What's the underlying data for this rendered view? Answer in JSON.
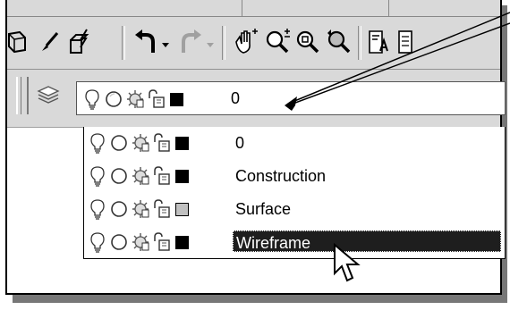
{
  "layer_toolbar": {
    "current_layer": {
      "name": "0",
      "color": "#000000"
    }
  },
  "layer_dropdown": {
    "items": [
      {
        "name": "0",
        "color": "#000000",
        "selected": false
      },
      {
        "name": "Construction",
        "color": "#000000",
        "selected": false
      },
      {
        "name": "Surface",
        "color": "#c0c0c0",
        "selected": false
      },
      {
        "name": "Wireframe",
        "color": "#000000",
        "selected": true
      }
    ]
  },
  "icons": {
    "toolbar": [
      "new-3d-icon",
      "match-properties-brush-icon",
      "paint-lightning-icon",
      "undo-icon",
      "redo-icon",
      "pan-hand-icon",
      "zoom-realtime-icon",
      "zoom-window-icon",
      "zoom-previous-icon",
      "text-style-icon"
    ],
    "layer_row": [
      "lightbulb-on-off-icon",
      "freeze-thaw-sun-icon",
      "viewport-freeze-icon",
      "lock-unlock-icon"
    ],
    "layer_manager": "layers-stack-icon"
  },
  "colors": {
    "selection_bg": "#1e1e1e",
    "toolbar_bg": "#d9d9d9"
  }
}
